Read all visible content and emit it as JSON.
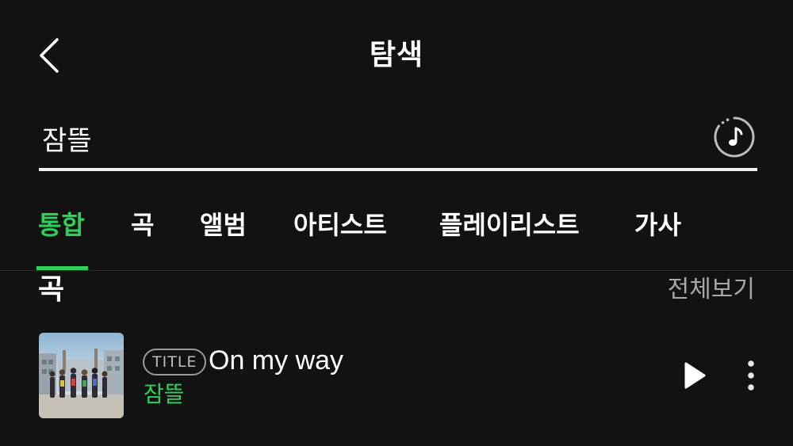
{
  "header": {
    "title": "탐색"
  },
  "search": {
    "query": "잠뜰",
    "placeholder": ""
  },
  "tabs": [
    {
      "label": "통합",
      "active": true
    },
    {
      "label": "곡"
    },
    {
      "label": "앨범"
    },
    {
      "label": "아티스트"
    },
    {
      "label": "플레이리스트"
    },
    {
      "label": "가사"
    }
  ],
  "section": {
    "title": "곡",
    "view_all": "전체보기"
  },
  "songs": [
    {
      "badge": "TITLE",
      "title": "On my way",
      "artist": "잠뜰"
    }
  ],
  "colors": {
    "background": "#121212",
    "accent": "#2fd05a",
    "secondary_text": "#a8a8a8"
  },
  "icons": {
    "back": "chevron-left-icon",
    "music_search": "music-note-circle-icon",
    "play": "play-icon",
    "more": "more-vertical-icon"
  }
}
